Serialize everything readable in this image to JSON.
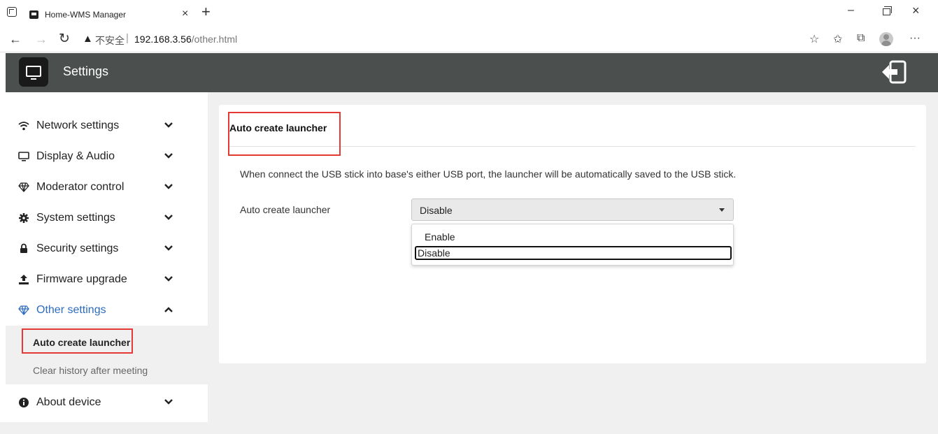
{
  "browser": {
    "tab_title": "Home-WMS Manager",
    "tab_close": "×",
    "new_tab": "+",
    "insecure_label": "不安全",
    "url_separator": "|",
    "url_host": "192.168.3.56",
    "url_path": "/other.html",
    "window_controls": {
      "minimize": "–",
      "close": "×"
    },
    "toolbar_icons": [
      "favorites-add-icon",
      "favorites-icon",
      "collections-icon",
      "profile-icon",
      "more-icon"
    ],
    "more_label": "···"
  },
  "header": {
    "title": "Settings",
    "background_color": "#4b4f4d"
  },
  "sidebar": {
    "items": [
      {
        "label": "Network settings",
        "icon": "wifi-icon",
        "expanded": false
      },
      {
        "label": "Display & Audio",
        "icon": "monitor-icon",
        "expanded": false
      },
      {
        "label": "Moderator control",
        "icon": "diamond-icon",
        "expanded": false
      },
      {
        "label": "System settings",
        "icon": "gear-icon",
        "expanded": false
      },
      {
        "label": "Security settings",
        "icon": "lock-icon",
        "expanded": false
      },
      {
        "label": "Firmware upgrade",
        "icon": "upload-icon",
        "expanded": false
      },
      {
        "label": "Other settings",
        "icon": "diamond-icon",
        "expanded": true
      },
      {
        "label": "About device",
        "icon": "info-icon",
        "expanded": false
      }
    ],
    "submenu": {
      "current": "Auto create launcher",
      "other": "Clear history after meeting"
    },
    "active_color": "#2d6cc0"
  },
  "main": {
    "card_title": "Auto create launcher",
    "description": "When connect the USB stick into base's either USB port, the launcher will be automatically saved to the USB stick.",
    "field_label": "Auto create launcher",
    "select": {
      "value": "Disable",
      "options": [
        "Enable",
        "Disable"
      ],
      "highlighted": "Disable"
    }
  },
  "highlight_color": "#e53935"
}
